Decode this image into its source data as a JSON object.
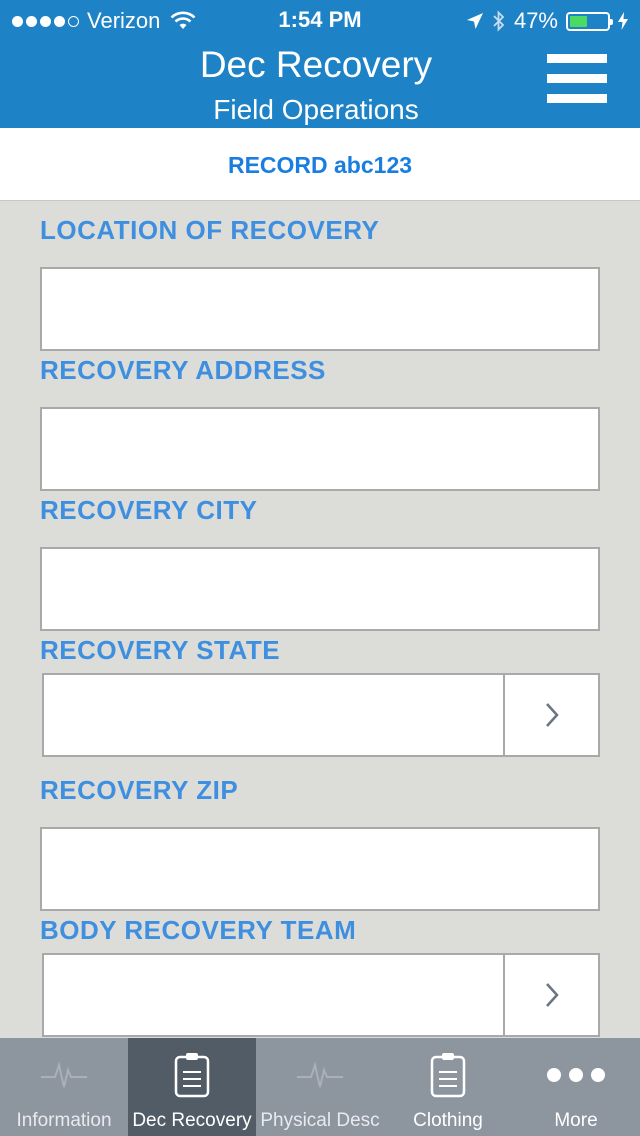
{
  "status_bar": {
    "carrier": "Verizon",
    "time": "1:54 PM",
    "battery_percent": "47%",
    "battery_level": 0.47
  },
  "header": {
    "title": "Dec Recovery",
    "subtitle": "Field Operations",
    "menu_icon": "hamburger-menu-icon"
  },
  "record": {
    "label": "RECORD abc123"
  },
  "form": {
    "fields": [
      {
        "label": "LOCATION OF RECOVERY",
        "value": "",
        "type": "text"
      },
      {
        "label": "RECOVERY ADDRESS",
        "value": "",
        "type": "text"
      },
      {
        "label": "RECOVERY CITY",
        "value": "",
        "type": "text"
      },
      {
        "label": "RECOVERY STATE",
        "value": "",
        "type": "select"
      },
      {
        "label": "RECOVERY ZIP",
        "value": "",
        "type": "text"
      },
      {
        "label": "BODY RECOVERY TEAM",
        "value": "",
        "type": "select"
      }
    ]
  },
  "tabbar": {
    "tabs": [
      {
        "label": "Information",
        "icon": "pulse-icon",
        "active": false
      },
      {
        "label": "Dec Recovery",
        "icon": "clipboard-icon",
        "active": true
      },
      {
        "label": "Physical Desc",
        "icon": "pulse-icon",
        "active": false
      },
      {
        "label": "Clothing",
        "icon": "clipboard-icon",
        "active": false
      },
      {
        "label": "More",
        "icon": "more-dots-icon",
        "active": false
      }
    ]
  },
  "colors": {
    "header_bg": "#1e82c6",
    "label_blue": "#3f8fe0",
    "record_blue": "#1a7de0",
    "form_bg": "#dcdcd8",
    "tabbar_bg": "#8d959f",
    "tab_active_bg": "#525c66",
    "battery_green": "#4cd964"
  }
}
